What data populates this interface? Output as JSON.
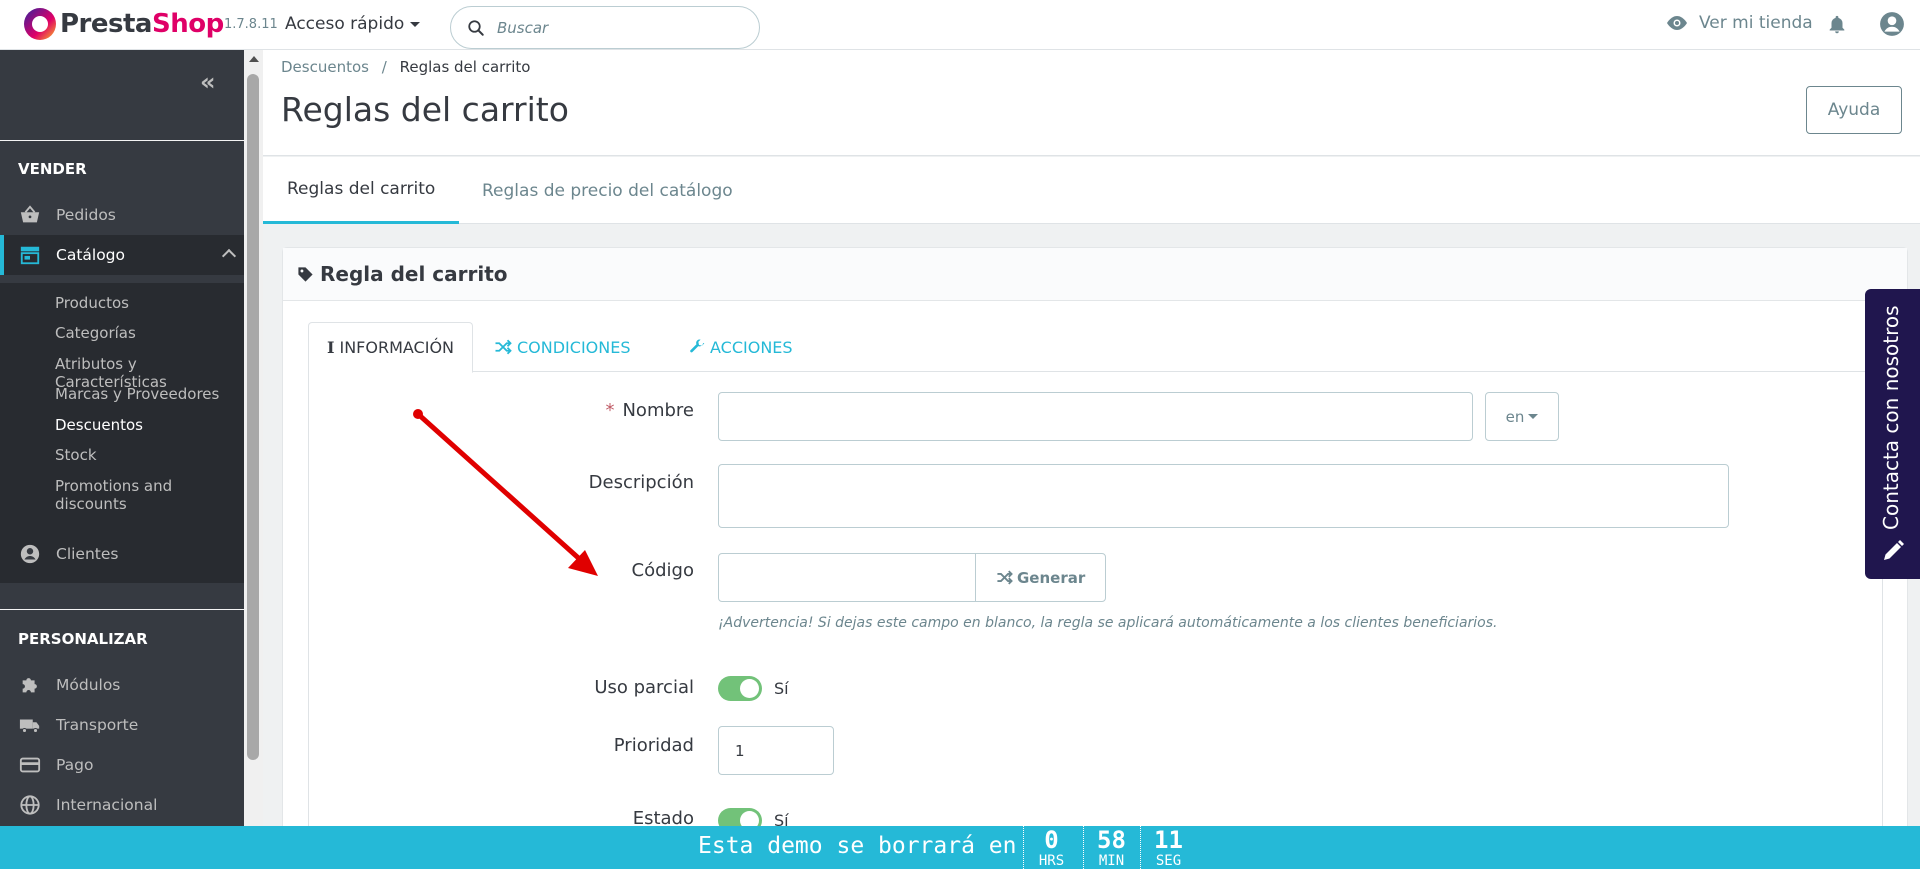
{
  "header": {
    "logo_presta": "Presta",
    "logo_shop": "Shop",
    "version": "1.7.8.11",
    "quick_access": "Acceso rápido",
    "search_placeholder": "Buscar",
    "view_store": "Ver mi tienda"
  },
  "sidebar": {
    "collapse": "«",
    "section_sell": "VENDER",
    "orders": "Pedidos",
    "catalog": "Catálogo",
    "catalog_items": [
      "Productos",
      "Categorías",
      "Atributos y Características",
      "Marcas y Proveedores",
      "Descuentos",
      "Stock",
      "Promotions and discounts"
    ],
    "customers": "Clientes",
    "section_customize": "PERSONALIZAR",
    "modules": "Módulos",
    "shipping": "Transporte",
    "payment": "Pago",
    "international": "Internacional"
  },
  "page": {
    "breadcrumb_parent": "Descuentos",
    "breadcrumb_sep": "/",
    "breadcrumb_current": "Reglas del carrito",
    "title": "Reglas del carrito",
    "help": "Ayuda",
    "tab_cart_rules": "Reglas del carrito",
    "tab_catalog_price_rules": "Reglas de precio del catálogo"
  },
  "panel": {
    "title": "Regla del carrito",
    "tab_info": "INFORMACIÓN",
    "tab_conditions": "CONDICIONES",
    "tab_actions": "ACCIONES",
    "name_required": "*",
    "name_label": "Nombre",
    "name_value": "",
    "lang": "en",
    "description_label": "Descripción",
    "description_value": "",
    "code_label": "Código",
    "code_value": "",
    "generate": "Generar",
    "code_hint": "¡Advertencia! Si dejas este campo en blanco, la regla se aplicará automáticamente a los clientes beneficiarios.",
    "partial_use_label": "Uso parcial",
    "partial_use_value": "Sí",
    "priority_label": "Prioridad",
    "priority_value": "1",
    "status_label": "Estado",
    "status_value": "Sí"
  },
  "contact": {
    "label": "Contacta con nosotros"
  },
  "demo_bar": {
    "text": "Esta demo se borrará en",
    "hours": "0",
    "hours_unit": "HRS",
    "minutes": "58",
    "minutes_unit": "MIN",
    "seconds": "11",
    "seconds_unit": "SEG"
  },
  "colors": {
    "accent": "#25b9d7",
    "sidebar_bg": "#363a41",
    "brand_pink": "#df0067",
    "switch_on": "#72c279",
    "contact_bg": "#20164e",
    "annotation_arrow": "#e00000"
  }
}
